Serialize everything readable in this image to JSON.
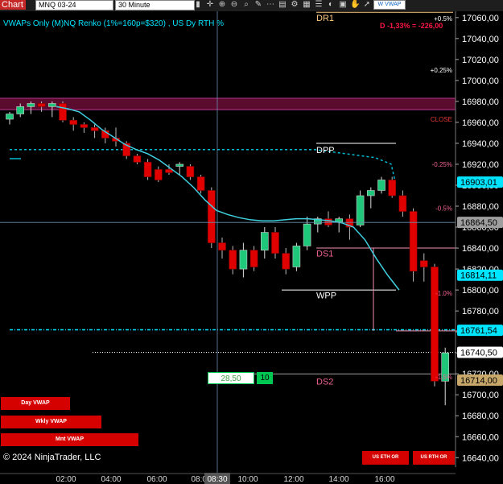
{
  "toolbar": {
    "chart_tab": "Chart",
    "instrument": "MNQ 03-24",
    "timeframe": "30 Minute",
    "vwap_button": "W VWAP",
    "icons": [
      "bars-icon",
      "crosshair-icon",
      "zoom-in-icon",
      "zoom-out-icon",
      "search-icon",
      "tools-icon",
      "dots-icon",
      "template-icon",
      "properties-icon",
      "grid-icon",
      "list-icon",
      "palette-icon",
      "layout-icon",
      "hand-icon",
      "cursor-icon",
      "globe-icon",
      "tag-icon"
    ]
  },
  "header": {
    "title": "VWAPs Only (M)NQ Renko (1%=160p=$320) , US Dy RTH %",
    "pnl": "D -1,33% = -226,00"
  },
  "buttons": {
    "day_vwap": "Day VWAP",
    "wkly_vwap": "Wkly VWAP",
    "mnt_vwap": "Mnt VWAP",
    "us_eth_or": "US ETH OR",
    "us_rth_or": "US RTH OR"
  },
  "order_entry": {
    "price": "28,50",
    "qty": "10"
  },
  "copyright": "© 2024 NinjaTrader, LLC",
  "chart_data": {
    "type": "candlestick",
    "x_ticks": [
      "02:00",
      "04:00",
      "06:00",
      "08:00",
      "08:30",
      "10:00",
      "12:00",
      "14:00",
      "16:00"
    ],
    "y_ticks": [
      "17060,00",
      "17040,00",
      "17020,00",
      "17000,00",
      "16980,00",
      "16960,00",
      "16940,00",
      "16920,00",
      "16900,00",
      "16880,00",
      "16860,00",
      "16840,00",
      "16820,00",
      "16800,00",
      "16780,00",
      "16760,00",
      "16740,00",
      "16720,00",
      "16700,00",
      "16680,00",
      "16660,00",
      "16640,00"
    ],
    "ylim": [
      16631,
      17066
    ],
    "price_labels": [
      {
        "text": "16903,01",
        "value": 16903.01,
        "color": "#00e5ff"
      },
      {
        "text": "16864,50",
        "value": 16864.5,
        "color": "#9e9e9e"
      },
      {
        "text": "16814,11",
        "value": 16814.11,
        "color": "#00e5ff"
      },
      {
        "text": "16761,54",
        "value": 16761.54,
        "color": "#00e5ff"
      },
      {
        "text": "16740,50",
        "value": 16740.5,
        "color": "#ffffff"
      },
      {
        "text": "16714,00",
        "value": 16714.0,
        "color": "#c8a86a"
      }
    ],
    "pct_labels": [
      {
        "text": "+0.5%",
        "value": 17059,
        "color": "#ffffff"
      },
      {
        "text": "+0.25%",
        "value": 17010,
        "color": "#ffffff"
      },
      {
        "text": "CLOSE",
        "value": 16963,
        "color": "#e53935"
      },
      {
        "text": "-0.25%",
        "value": 16920,
        "color": "#f06292"
      },
      {
        "text": "-0.5%",
        "value": 16878,
        "color": "#f06292"
      },
      {
        "text": "-1.0%",
        "value": 16797,
        "color": "#f06292"
      },
      {
        "text": "-1.5%",
        "value": 16717,
        "color": "#f06292"
      }
    ],
    "level_labels": [
      {
        "text": "DR1",
        "value": 17060,
        "color": "#ffcc80"
      },
      {
        "text": "DPP",
        "value": 16934,
        "color": "#ffffff"
      },
      {
        "text": "DS1",
        "value": 16835,
        "color": "#f06292"
      },
      {
        "text": "WPP",
        "value": 16795,
        "color": "#ffffff"
      },
      {
        "text": "DS2",
        "value": 16713,
        "color": "#f06292"
      }
    ],
    "candles": [
      {
        "o": 16963,
        "h": 16970,
        "l": 16958,
        "c": 16968
      },
      {
        "o": 16968,
        "h": 16978,
        "l": 16965,
        "c": 16975
      },
      {
        "o": 16975,
        "h": 16980,
        "l": 16968,
        "c": 16978
      },
      {
        "o": 16978,
        "h": 16980,
        "l": 16970,
        "c": 16975
      },
      {
        "o": 16975,
        "h": 16980,
        "l": 16965,
        "c": 16978
      },
      {
        "o": 16978,
        "h": 16980,
        "l": 16960,
        "c": 16962
      },
      {
        "o": 16962,
        "h": 16965,
        "l": 16952,
        "c": 16958
      },
      {
        "o": 16958,
        "h": 16960,
        "l": 16950,
        "c": 16955
      },
      {
        "o": 16955,
        "h": 16958,
        "l": 16945,
        "c": 16952
      },
      {
        "o": 16952,
        "h": 16955,
        "l": 16940,
        "c": 16945
      },
      {
        "o": 16945,
        "h": 16955,
        "l": 16937,
        "c": 16942
      },
      {
        "o": 16940,
        "h": 16942,
        "l": 16925,
        "c": 16928
      },
      {
        "o": 16928,
        "h": 16930,
        "l": 16920,
        "c": 16922
      },
      {
        "o": 16922,
        "h": 16925,
        "l": 16905,
        "c": 16908
      },
      {
        "o": 16915,
        "h": 16918,
        "l": 16903,
        "c": 16905
      },
      {
        "o": 16915,
        "h": 16920,
        "l": 16910,
        "c": 16912
      },
      {
        "o": 16918,
        "h": 16922,
        "l": 16910,
        "c": 16920
      },
      {
        "o": 16918,
        "h": 16920,
        "l": 16905,
        "c": 16908
      },
      {
        "o": 16908,
        "h": 16910,
        "l": 16892,
        "c": 16895
      },
      {
        "o": 16895,
        "h": 16898,
        "l": 16840,
        "c": 16845
      },
      {
        "o": 16845,
        "h": 16850,
        "l": 16830,
        "c": 16838
      },
      {
        "o": 16838,
        "h": 16842,
        "l": 16815,
        "c": 16820
      },
      {
        "o": 16820,
        "h": 16845,
        "l": 16812,
        "c": 16838
      },
      {
        "o": 16838,
        "h": 16842,
        "l": 16818,
        "c": 16822
      },
      {
        "o": 16838,
        "h": 16860,
        "l": 16830,
        "c": 16855
      },
      {
        "o": 16855,
        "h": 16860,
        "l": 16830,
        "c": 16835
      },
      {
        "o": 16835,
        "h": 16840,
        "l": 16815,
        "c": 16820
      },
      {
        "o": 16822,
        "h": 16845,
        "l": 16818,
        "c": 16842
      },
      {
        "o": 16842,
        "h": 16870,
        "l": 16838,
        "c": 16863
      },
      {
        "o": 16863,
        "h": 16870,
        "l": 16855,
        "c": 16868
      },
      {
        "o": 16868,
        "h": 16875,
        "l": 16860,
        "c": 16862
      },
      {
        "o": 16865,
        "h": 16870,
        "l": 16855,
        "c": 16868
      },
      {
        "o": 16868,
        "h": 16872,
        "l": 16848,
        "c": 16860
      },
      {
        "o": 16862,
        "h": 16895,
        "l": 16860,
        "c": 16890
      },
      {
        "o": 16890,
        "h": 16898,
        "l": 16878,
        "c": 16895
      },
      {
        "o": 16895,
        "h": 16908,
        "l": 16892,
        "c": 16905
      },
      {
        "o": 16905,
        "h": 16908,
        "l": 16888,
        "c": 16890
      },
      {
        "o": 16890,
        "h": 16895,
        "l": 16870,
        "c": 16875
      },
      {
        "o": 16875,
        "h": 16878,
        "l": 16808,
        "c": 16818
      },
      {
        "o": 16828,
        "h": 16835,
        "l": 16808,
        "c": 16822
      },
      {
        "o": 16822,
        "h": 16825,
        "l": 16708,
        "c": 16713
      },
      {
        "o": 16713,
        "h": 16745,
        "l": 16690,
        "c": 16740
      }
    ],
    "day_vwap": [
      16975,
      16973,
      16970,
      16962,
      16953,
      16946,
      16939,
      16934,
      16930,
      16924,
      16916,
      16908,
      16898,
      16886,
      16876,
      16872,
      16869,
      16867,
      16866,
      16866,
      16867,
      16868,
      16868,
      16867,
      16866,
      16864,
      16860,
      16848,
      16830,
      16814,
      16800
    ],
    "wkly_vwap": 16934,
    "mnt_vwap": 16762,
    "close_zone": [
      16972,
      16983
    ],
    "or_close": 16740.5
  }
}
